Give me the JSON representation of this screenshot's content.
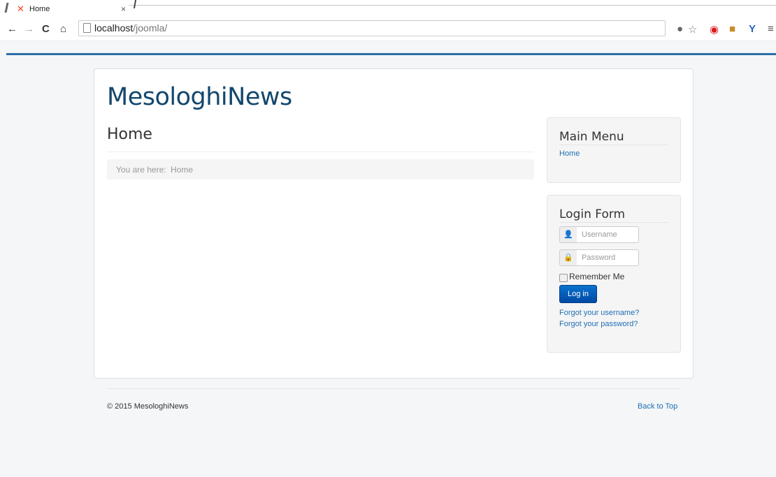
{
  "browser": {
    "tab_title": "Home",
    "tab_close": "×",
    "url_host": "localhost",
    "url_path": "/joomla/"
  },
  "site": {
    "brand": "MesologhiNews",
    "page_title": "Home",
    "breadcrumb_label": "You are here:",
    "breadcrumb_current": "Home"
  },
  "main_menu": {
    "title": "Main Menu",
    "items": [
      "Home"
    ]
  },
  "login": {
    "title": "Login Form",
    "username_placeholder": "Username",
    "password_placeholder": "Password",
    "remember_label": "Remember Me",
    "login_button": "Log in",
    "forgot_username": "Forgot your username?",
    "forgot_password": "Forgot your password?"
  },
  "footer": {
    "copyright": "© 2015 MesologhiNews",
    "back_to_top": "Back to Top"
  },
  "colors": {
    "accent": "#2b6ea8",
    "brand": "#12476d",
    "link": "#1f6fb5",
    "button": "#0a5fc0"
  }
}
